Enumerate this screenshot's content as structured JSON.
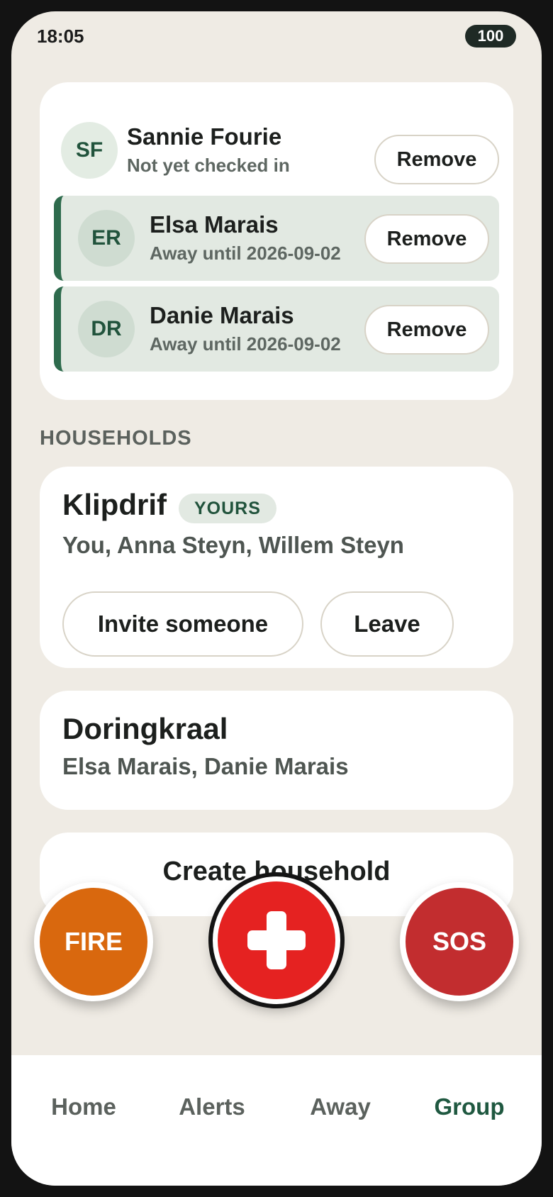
{
  "status_bar": {
    "time": "18:05",
    "battery": "100"
  },
  "members": [
    {
      "initials": "SF",
      "name": "Sannie Fourie",
      "status": "Not yet checked in",
      "away": false,
      "action": "Remove"
    },
    {
      "initials": "ER",
      "name": "Elsa Marais",
      "status": "Away until 2026-09-02",
      "away": true,
      "action": "Remove"
    },
    {
      "initials": "DR",
      "name": "Danie Marais",
      "status": "Away until 2026-09-02",
      "away": true,
      "action": "Remove"
    }
  ],
  "households_section": {
    "title": "HOUSEHOLDS",
    "households": [
      {
        "name": "Klipdrif",
        "badge": "YOURS",
        "members": "You, Anna Steyn, Willem Steyn",
        "actions": [
          "Invite someone",
          "Leave"
        ]
      },
      {
        "name": "Doringkraal",
        "members": "Elsa Marais, Danie Marais"
      }
    ],
    "create_label": "Create household"
  },
  "emergency": {
    "fire_label": "FIRE",
    "sos_label": "SOS",
    "medical_icon": "medical-cross-icon"
  },
  "nav": {
    "items": [
      "Home",
      "Alerts",
      "Away",
      "Group"
    ],
    "active": "Group"
  },
  "colors": {
    "accent": "#1f5840",
    "away_bar": "#2e6b4d",
    "fire": "#d9680e",
    "medical": "#e52221",
    "sos": "#c22d2f"
  }
}
